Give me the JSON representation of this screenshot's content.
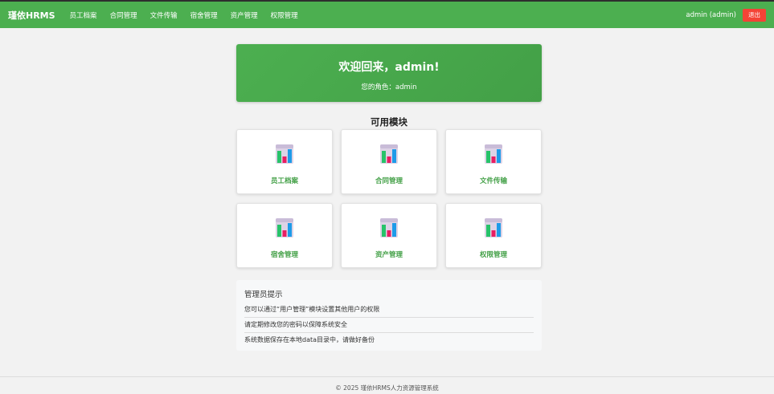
{
  "navbar": {
    "brand": "瑾依HRMS",
    "items": [
      "员工档案",
      "合同管理",
      "文件传输",
      "宿舍管理",
      "资产管理",
      "权限管理"
    ],
    "user": "admin (admin)",
    "logout_label": "退出",
    "accent": "#4caf50",
    "logout_color": "#f44336"
  },
  "welcome": {
    "title": "欢迎回来，admin!",
    "role": "您的角色：admin"
  },
  "modules": {
    "title": "可用模块",
    "icon": "bar-chart-icon",
    "items": [
      "员工档案",
      "合同管理",
      "文件传输",
      "宿舍管理",
      "资产管理",
      "权限管理"
    ]
  },
  "tips": {
    "title": "管理员提示",
    "items": [
      "您可以通过“用户管理”模块设置其他用户的权限",
      "请定期修改您的密码以保障系统安全",
      "系统数据保存在本地data目录中，请做好备份"
    ]
  },
  "footer": {
    "text": "© 2025 瑾依HRMS人力资源管理系统"
  }
}
